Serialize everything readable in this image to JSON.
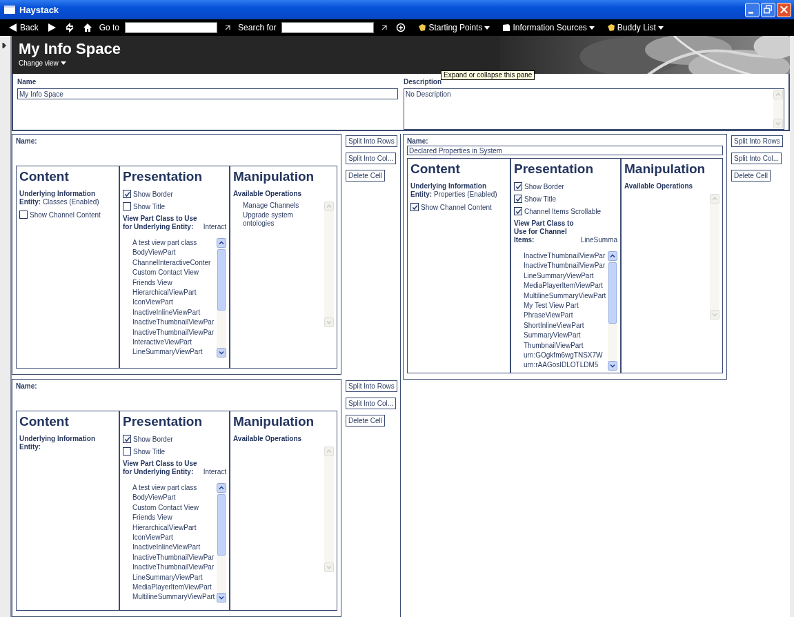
{
  "window": {
    "title": "Haystack"
  },
  "toolbar": {
    "back": "Back",
    "goto_label": "Go to",
    "search_label": "Search for",
    "menus": [
      "Starting Points",
      "Information Sources",
      "Buddy List"
    ]
  },
  "header": {
    "title": "My Info Space",
    "change_view": "Change view"
  },
  "tooltip": "Expand or collapse this pane",
  "properties": {
    "name_label": "Name",
    "name_value": "My Info Space",
    "description_label": "Description",
    "description_value": "No Description"
  },
  "left_cells": [
    {
      "name_label": "Name:",
      "content": {
        "heading": "Content",
        "entity_label": "Underlying Information Entity:",
        "entity_value": "Classes (Enabled)",
        "options": [
          {
            "label": "Show Channel Content",
            "checked": false
          }
        ]
      },
      "presentation": {
        "heading": "Presentation",
        "options": [
          {
            "label": "Show Border",
            "checked": true
          },
          {
            "label": "Show Title",
            "checked": false
          }
        ],
        "view_part_label": "View Part Class to Use for Underlying Entity:",
        "view_part_value": "Interact",
        "view_parts": [
          "A test view part class",
          "BodyViewPart",
          "ChannelInteractiveConter",
          "Custom Contact View",
          "Friends View",
          "HierarchicalViewPart",
          "IconViewPart",
          "InactiveInlineViewPart",
          "InactiveThumbnailViewPar",
          "InactiveThumbnailViewPar",
          "InteractiveViewPart",
          "LineSummaryViewPart"
        ]
      },
      "manipulation": {
        "heading": "Manipulation",
        "label": "Available Operations",
        "operations": [
          "Manage Channels",
          "Upgrade system ontologies"
        ]
      },
      "buttons": [
        "Split Into Rows",
        "Split Into Col...",
        "Delete Cell"
      ]
    },
    {
      "name_label": "Name:",
      "content": {
        "heading": "Content",
        "entity_label": "Underlying Information Entity:"
      },
      "presentation": {
        "heading": "Presentation",
        "options": [
          {
            "label": "Show Border",
            "checked": true
          },
          {
            "label": "Show Title",
            "checked": false
          }
        ],
        "view_part_label": "View Part Class to Use for Underlying Entity:",
        "view_part_value": "Interact",
        "view_parts": [
          "A test view part class",
          "BodyViewPart",
          "Custom Contact View",
          "Friends View",
          "HierarchicalViewPart",
          "IconViewPart",
          "InactiveInlineViewPart",
          "InactiveThumbnailViewPar",
          "InactiveThumbnailViewPar",
          "LineSummaryViewPart",
          "MediaPlayerItemViewPart",
          "MultilineSummaryViewPart"
        ]
      },
      "manipulation": {
        "heading": "Manipulation",
        "label": "Available Operations"
      },
      "buttons": [
        "Split Into Rows",
        "Split Into Col...",
        "Delete Cell"
      ]
    }
  ],
  "right_cells": [
    {
      "name_label": "Name:",
      "name_value": "Declared Properties in System",
      "content": {
        "heading": "Content",
        "entity_label": "Underlying Information Entity:",
        "entity_value": "Properties (Enabled)",
        "options": [
          {
            "label": "Show Channel Content",
            "checked": true
          }
        ]
      },
      "presentation": {
        "heading": "Presentation",
        "options": [
          {
            "label": "Show Border",
            "checked": true
          },
          {
            "label": "Show Title",
            "checked": true
          },
          {
            "label": "Channel Items Scrollable",
            "checked": true
          }
        ],
        "view_part_label": "View Part Class to Use for Channel Items:",
        "view_part_value": "LineSumma",
        "view_parts": [
          "InactiveThumbnailViewPar",
          "InactiveThumbnailViewPar",
          "LineSummaryViewPart",
          "MediaPlayerItemViewPart",
          "MultilineSummaryViewPart",
          "My Test View Part",
          "PhraseViewPart",
          "ShortInlineViewPart",
          "SummaryViewPart",
          "ThumbnailViewPart",
          "urn:GOgkfm6wgTNSX7W",
          "urn:rAAGosIDLOTLDM5"
        ]
      },
      "manipulation": {
        "heading": "Manipulation",
        "label": "Available Operations"
      },
      "buttons": [
        "Split Into Rows",
        "Split Into Col...",
        "Delete Cell"
      ]
    }
  ]
}
